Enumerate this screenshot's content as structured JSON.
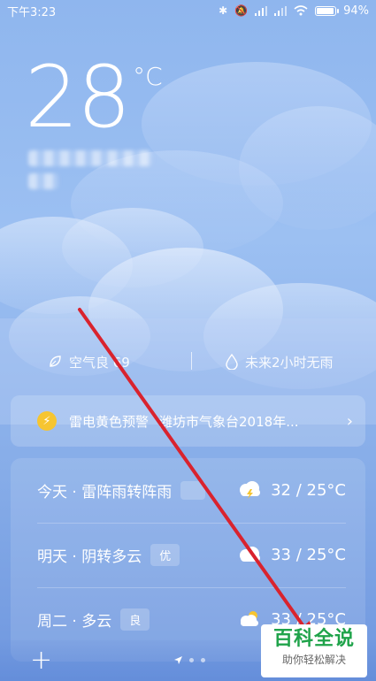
{
  "status_bar": {
    "time": "下午3:23",
    "battery": "94%",
    "battery_level": 0.94
  },
  "current": {
    "temperature": "28",
    "unit": "°C"
  },
  "air_row": {
    "air_quality": "空气良 69",
    "rain_forecast": "未来2小时无雨"
  },
  "warning": {
    "title": "雷电黄色预警",
    "org": "潍坊市气象台2018年..."
  },
  "forecast": [
    {
      "label": "今天 · 雷阵雨转阵雨",
      "badge": "",
      "icon": "thunderstorm-icon",
      "temps": "32 / 25°C"
    },
    {
      "label": "明天 · 阴转多云",
      "badge": "优",
      "icon": "cloud-icon",
      "temps": "33 / 25°C"
    },
    {
      "label": "周二 · 多云",
      "badge": "良",
      "icon": "partly-cloudy-icon",
      "temps": "33 / 25°C"
    }
  ],
  "bottom": {
    "add_label": "+"
  },
  "watermark": {
    "main": "百科全说",
    "sub": "助你轻松解决"
  },
  "colors": {
    "bolt": "#f6c531",
    "annotation_line": "#d9232e",
    "watermark_green": "#1fa34a"
  }
}
